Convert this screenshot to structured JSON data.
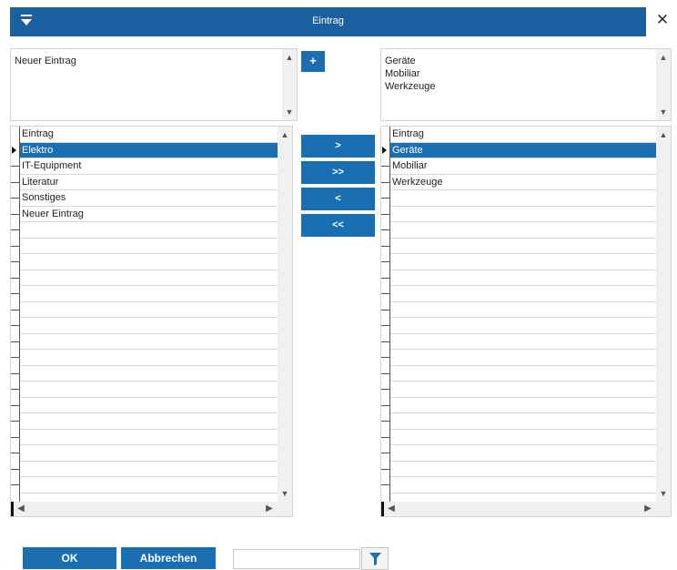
{
  "window": {
    "title": "Eintrag",
    "close_glyph": "✕",
    "menu_icon": "chevron-down-icon"
  },
  "new_entry": {
    "text": "Neuer Eintrag",
    "add_glyph": "+"
  },
  "selected_text": {
    "lines": [
      "Geräte",
      "Mobiliar",
      "Werkzeuge"
    ]
  },
  "left_grid": {
    "header": "Eintrag",
    "rows": [
      "Elektro",
      "IT-Equipment",
      "Literatur",
      "Sonstiges",
      "Neuer Eintrag"
    ],
    "selected_index": 0
  },
  "right_grid": {
    "header": "Eintrag",
    "rows": [
      "Geräte",
      "Mobiliar",
      "Werkzeuge"
    ],
    "selected_index": 0
  },
  "move_buttons": {
    "add_one": ">",
    "add_all": ">>",
    "remove_one": "<",
    "remove_all": "<<"
  },
  "footer": {
    "ok": "OK",
    "cancel": "Abbrechen",
    "filter_value": "",
    "filter_icon": "funnel-icon"
  },
  "colors": {
    "accent": "#1a6fb3",
    "titlebar": "#1a5fa0"
  }
}
